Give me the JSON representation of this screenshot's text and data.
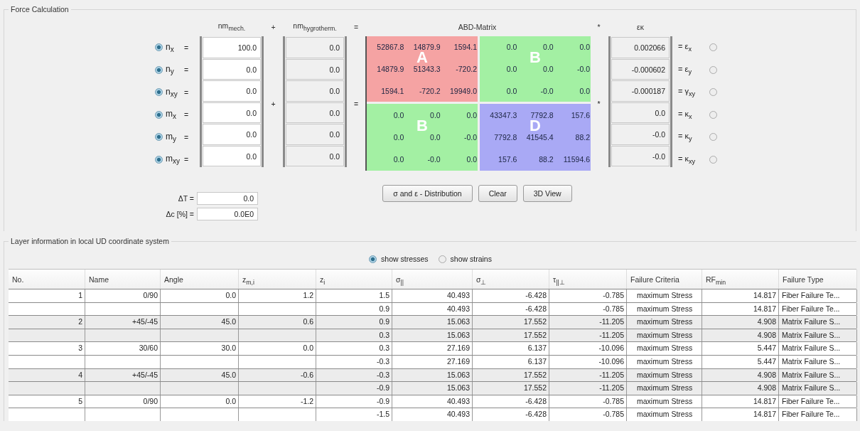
{
  "force_calculation": {
    "title": "Force Calculation",
    "headers": {
      "mech": "nm$_{mech.}$",
      "plus": "+",
      "hygro": "nm$_{hygrotherm.}$",
      "equals": "=",
      "matrix": "ABD-Matrix",
      "times": "*",
      "strain": "εκ"
    },
    "operators": {
      "plus": "+",
      "equals": "=",
      "times": "*"
    },
    "load_rows": [
      {
        "label": "n$_{x}$",
        "eq": "=",
        "mech": "100.0",
        "hygro": "0.0",
        "selected": true
      },
      {
        "label": "n$_{y}$",
        "eq": "=",
        "mech": "0.0",
        "hygro": "0.0",
        "selected": true
      },
      {
        "label": "n$_{xy}$",
        "eq": "=",
        "mech": "0.0",
        "hygro": "0.0",
        "selected": true
      },
      {
        "label": "m$_{x}$",
        "eq": "=",
        "mech": "0.0",
        "hygro": "0.0",
        "selected": true
      },
      {
        "label": "m$_{y}$",
        "eq": "=",
        "mech": "0.0",
        "hygro": "0.0",
        "selected": true
      },
      {
        "label": "m$_{xy}$",
        "eq": "=",
        "mech": "0.0",
        "hygro": "0.0",
        "selected": true
      }
    ],
    "matrix": {
      "quadrants": [
        {
          "letter": "A",
          "color": "#f5a3a3",
          "rows": [
            [
              "52867.8",
              "14879.9",
              "1594.1"
            ],
            [
              "14879.9",
              "51343.3",
              "-720.2"
            ],
            [
              "1594.1",
              "-720.2",
              "19949.0"
            ]
          ]
        },
        {
          "letter": "B",
          "color": "#a3f0a3",
          "rows": [
            [
              "0.0",
              "0.0",
              "0.0"
            ],
            [
              "0.0",
              "0.0",
              "-0.0"
            ],
            [
              "0.0",
              "-0.0",
              "0.0"
            ]
          ]
        },
        {
          "letter": "B",
          "color": "#a3f0a3",
          "rows": [
            [
              "0.0",
              "0.0",
              "0.0"
            ],
            [
              "0.0",
              "0.0",
              "-0.0"
            ],
            [
              "0.0",
              "-0.0",
              "0.0"
            ]
          ]
        },
        {
          "letter": "D",
          "color": "#a9a9f5",
          "rows": [
            [
              "43347.3",
              "7792.8",
              "157.6"
            ],
            [
              "7792.8",
              "41545.4",
              "88.2"
            ],
            [
              "157.6",
              "88.2",
              "11594.6"
            ]
          ]
        }
      ]
    },
    "strain_rows": [
      {
        "value": "0.002066",
        "label": "= ε$_{x}$",
        "selected": false
      },
      {
        "value": "-0.000602",
        "label": "= ε$_{y}$",
        "selected": false
      },
      {
        "value": "-0.000187",
        "label": "= γ$_{xy}$",
        "selected": false
      },
      {
        "value": "0.0",
        "label": "= κ$_{x}$",
        "selected": false
      },
      {
        "value": "-0.0",
        "label": "= κ$_{y}$",
        "selected": false
      },
      {
        "value": "-0.0",
        "label": "= κ$_{xy}$",
        "selected": false
      }
    ],
    "extra_fields": [
      {
        "label": "ΔT =",
        "value": "0.0"
      },
      {
        "label": "Δc [%] =",
        "value": "0.0E0"
      }
    ],
    "buttons": [
      "σ and ε - Distribution",
      "Clear",
      "3D View"
    ]
  },
  "layer_section": {
    "title": "Layer information in local UD coordinate system",
    "view_options": [
      {
        "label": "show stresses",
        "selected": true
      },
      {
        "label": "show strains",
        "selected": false
      }
    ],
    "table": {
      "columns": [
        "No.",
        "Name",
        "Angle",
        "z$_{m,i}$",
        "z$_{i}$",
        "σ$_{||}$",
        "σ$_{⊥}$",
        "τ$_{||⊥}$",
        "Failure Criteria",
        "RF$_{min}$",
        "Failure Type"
      ],
      "rows": [
        [
          "1",
          "0/90",
          "0.0",
          "1.2",
          "1.5",
          "40.493",
          "-6.428",
          "-0.785",
          "maximum Stress",
          "14.817",
          "Fiber Failure Te..."
        ],
        [
          null,
          null,
          null,
          null,
          "0.9",
          "40.493",
          "-6.428",
          "-0.785",
          "maximum Stress",
          "14.817",
          "Fiber Failure Te..."
        ],
        [
          "2",
          "+45/-45",
          "45.0",
          "0.6",
          "0.9",
          "15.063",
          "17.552",
          "-11.205",
          "maximum Stress",
          "4.908",
          "Matrix Failure S..."
        ],
        [
          null,
          null,
          null,
          null,
          "0.3",
          "15.063",
          "17.552",
          "-11.205",
          "maximum Stress",
          "4.908",
          "Matrix Failure S..."
        ],
        [
          "3",
          "30/60",
          "30.0",
          "0.0",
          "0.3",
          "27.169",
          "6.137",
          "-10.096",
          "maximum Stress",
          "5.447",
          "Matrix Failure S..."
        ],
        [
          null,
          null,
          null,
          null,
          "-0.3",
          "27.169",
          "6.137",
          "-10.096",
          "maximum Stress",
          "5.447",
          "Matrix Failure S..."
        ],
        [
          "4",
          "+45/-45",
          "45.0",
          "-0.6",
          "-0.3",
          "15.063",
          "17.552",
          "-11.205",
          "maximum Stress",
          "4.908",
          "Matrix Failure S..."
        ],
        [
          null,
          null,
          null,
          null,
          "-0.9",
          "15.063",
          "17.552",
          "-11.205",
          "maximum Stress",
          "4.908",
          "Matrix Failure S..."
        ],
        [
          "5",
          "0/90",
          "0.0",
          "-1.2",
          "-0.9",
          "40.493",
          "-6.428",
          "-0.785",
          "maximum Stress",
          "14.817",
          "Fiber Failure Te..."
        ],
        [
          null,
          null,
          null,
          null,
          "-1.5",
          "40.493",
          "-6.428",
          "-0.785",
          "maximum Stress",
          "14.817",
          "Fiber Failure Te..."
        ]
      ]
    }
  }
}
